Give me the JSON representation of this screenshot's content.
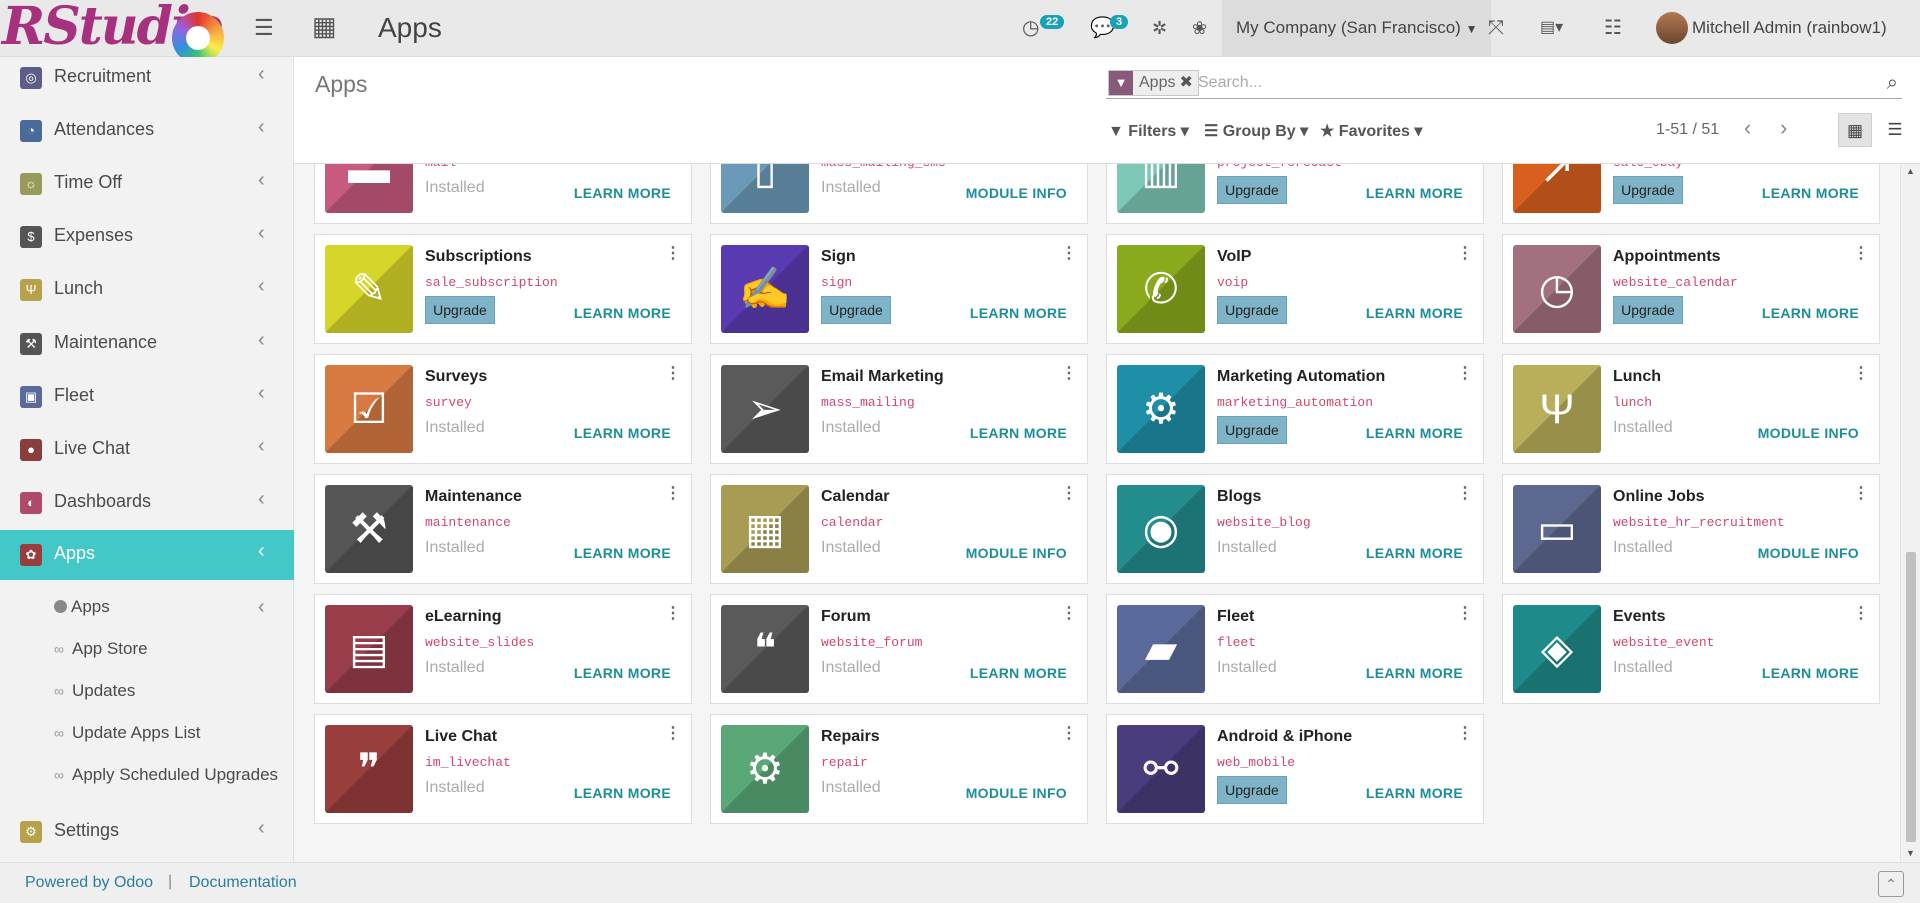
{
  "topbar": {
    "logo_text": "RStudio",
    "title": "Apps",
    "activities_count": "22",
    "messages_count": "3",
    "company": "My Company (San Francisco)",
    "user": "Mitchell Admin (rainbow1)"
  },
  "sidebar": {
    "items": [
      {
        "label": "Recruitment",
        "icon": "recruitment-icon",
        "color": "#5d5d8a"
      },
      {
        "label": "Attendances",
        "icon": "attendances-icon",
        "color": "#4a6a9a"
      },
      {
        "label": "Time Off",
        "icon": "time-off-icon",
        "color": "#9a9a5a"
      },
      {
        "label": "Expenses",
        "icon": "expenses-icon",
        "color": "#555555"
      },
      {
        "label": "Lunch",
        "icon": "lunch-icon",
        "color": "#b5a24a"
      },
      {
        "label": "Maintenance",
        "icon": "maintenance-icon",
        "color": "#555555"
      },
      {
        "label": "Fleet",
        "icon": "fleet-icon",
        "color": "#5a6a9a"
      },
      {
        "label": "Live Chat",
        "icon": "live-chat-icon",
        "color": "#8a3d3d"
      },
      {
        "label": "Dashboards",
        "icon": "dashboards-icon",
        "color": "#b04a6a"
      },
      {
        "label": "Apps",
        "icon": "apps-icon",
        "color": "#9a3d3d"
      },
      {
        "label": "Settings",
        "icon": "settings-icon",
        "color": "#b5a24a"
      }
    ],
    "sub_items": [
      "Apps",
      "App Store",
      "Updates",
      "Update Apps List",
      "Apply Scheduled Upgrades"
    ]
  },
  "control": {
    "title": "Apps",
    "facet": "Apps",
    "search_placeholder": "Search...",
    "filters": "Filters",
    "group_by": "Group By",
    "favorites": "Favorites",
    "pager": "1-51 / 51"
  },
  "cards": [
    {
      "name": "",
      "tech": "mail",
      "state": "Installed",
      "action": "LEARN MORE",
      "icon": "chat-bubble-icon",
      "color": "#c85a80"
    },
    {
      "name": "",
      "tech": "mass_mailing_sms",
      "state": "Installed",
      "action": "MODULE INFO",
      "icon": "sms-icon",
      "color": "#6a9ab7"
    },
    {
      "name": "",
      "tech": "project_forecast",
      "state": "Upgrade",
      "action": "LEARN MORE",
      "icon": "bar-chart-icon",
      "color": "#7cc7b5"
    },
    {
      "name": "",
      "tech": "sale_ebay",
      "state": "Upgrade",
      "action": "LEARN MORE",
      "icon": "trend-up-icon",
      "color": "#d95f1f"
    },
    {
      "name": "Subscriptions",
      "tech": "sale_subscription",
      "state": "Upgrade",
      "action": "LEARN MORE",
      "icon": "rss-pencil-icon",
      "color": "#d6d62a"
    },
    {
      "name": "Sign",
      "tech": "sign",
      "state": "Upgrade",
      "action": "LEARN MORE",
      "icon": "document-sign-icon",
      "color": "#5a3ab0"
    },
    {
      "name": "VoIP",
      "tech": "voip",
      "state": "Upgrade",
      "action": "LEARN MORE",
      "icon": "phone-icon",
      "color": "#8aaa1e"
    },
    {
      "name": "Appointments",
      "tech": "website_calendar",
      "state": "Upgrade",
      "action": "LEARN MORE",
      "icon": "calendar-clock-icon",
      "color": "#a3707d"
    },
    {
      "name": "Surveys",
      "tech": "survey",
      "state": "Installed",
      "action": "LEARN MORE",
      "icon": "clipboard-check-icon",
      "color": "#d77a42"
    },
    {
      "name": "Email Marketing",
      "tech": "mass_mailing",
      "state": "Installed",
      "action": "LEARN MORE",
      "icon": "paper-plane-icon",
      "color": "#5a5a5a"
    },
    {
      "name": "Marketing Automation",
      "tech": "marketing_automation",
      "state": "Upgrade",
      "action": "LEARN MORE",
      "icon": "gear-mail-icon",
      "color": "#1f8fa8"
    },
    {
      "name": "Lunch",
      "tech": "lunch",
      "state": "Installed",
      "action": "MODULE INFO",
      "icon": "fork-knife-icon",
      "color": "#b9ae5a"
    },
    {
      "name": "Maintenance",
      "tech": "maintenance",
      "state": "Installed",
      "action": "LEARN MORE",
      "icon": "hammer-icon",
      "color": "#555555"
    },
    {
      "name": "Calendar",
      "tech": "calendar",
      "state": "Installed",
      "action": "MODULE INFO",
      "icon": "calendar-icon",
      "color": "#a89c55"
    },
    {
      "name": "Blogs",
      "tech": "website_blog",
      "state": "Installed",
      "action": "LEARN MORE",
      "icon": "rss-icon",
      "color": "#238c8c"
    },
    {
      "name": "Online Jobs",
      "tech": "website_hr_recruitment",
      "state": "Installed",
      "action": "MODULE INFO",
      "icon": "briefcase-icon",
      "color": "#5d6890"
    },
    {
      "name": "eLearning",
      "tech": "website_slides",
      "state": "Installed",
      "action": "LEARN MORE",
      "icon": "presentation-icon",
      "color": "#9a3d4a"
    },
    {
      "name": "Forum",
      "tech": "website_forum",
      "state": "Installed",
      "action": "LEARN MORE",
      "icon": "forum-bubbles-icon",
      "color": "#5a5a5a"
    },
    {
      "name": "Fleet",
      "tech": "fleet",
      "state": "Installed",
      "action": "LEARN MORE",
      "icon": "car-icon",
      "color": "#5a6a9a"
    },
    {
      "name": "Events",
      "tech": "website_event",
      "state": "Installed",
      "action": "LEARN MORE",
      "icon": "ticket-icon",
      "color": "#1e8a8a"
    },
    {
      "name": "Live Chat",
      "tech": "im_livechat",
      "state": "Installed",
      "action": "LEARN MORE",
      "icon": "chat-bubbles-icon",
      "color": "#9a3d3d"
    },
    {
      "name": "Repairs",
      "tech": "repair",
      "state": "Installed",
      "action": "MODULE INFO",
      "icon": "wrench-gear-icon",
      "color": "#5aa877"
    },
    {
      "name": "Android & iPhone",
      "tech": "web_mobile",
      "state": "Upgrade",
      "action": "LEARN MORE",
      "icon": "handshake-icon",
      "color": "#4a3d7d"
    }
  ],
  "footer": {
    "powered": "Powered by Odoo",
    "separator": "|",
    "documentation": "Documentation"
  }
}
